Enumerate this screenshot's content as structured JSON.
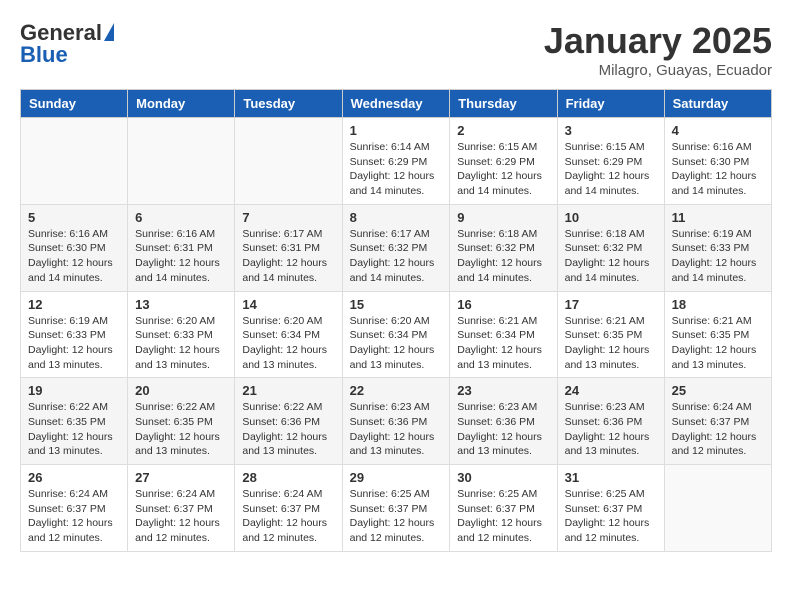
{
  "header": {
    "logo_general": "General",
    "logo_blue": "Blue",
    "month_title": "January 2025",
    "location": "Milagro, Guayas, Ecuador"
  },
  "days_of_week": [
    "Sunday",
    "Monday",
    "Tuesday",
    "Wednesday",
    "Thursday",
    "Friday",
    "Saturday"
  ],
  "weeks": [
    {
      "alt": false,
      "days": [
        {
          "num": "",
          "info": ""
        },
        {
          "num": "",
          "info": ""
        },
        {
          "num": "",
          "info": ""
        },
        {
          "num": "1",
          "info": "Sunrise: 6:14 AM\nSunset: 6:29 PM\nDaylight: 12 hours\nand 14 minutes."
        },
        {
          "num": "2",
          "info": "Sunrise: 6:15 AM\nSunset: 6:29 PM\nDaylight: 12 hours\nand 14 minutes."
        },
        {
          "num": "3",
          "info": "Sunrise: 6:15 AM\nSunset: 6:29 PM\nDaylight: 12 hours\nand 14 minutes."
        },
        {
          "num": "4",
          "info": "Sunrise: 6:16 AM\nSunset: 6:30 PM\nDaylight: 12 hours\nand 14 minutes."
        }
      ]
    },
    {
      "alt": true,
      "days": [
        {
          "num": "5",
          "info": "Sunrise: 6:16 AM\nSunset: 6:30 PM\nDaylight: 12 hours\nand 14 minutes."
        },
        {
          "num": "6",
          "info": "Sunrise: 6:16 AM\nSunset: 6:31 PM\nDaylight: 12 hours\nand 14 minutes."
        },
        {
          "num": "7",
          "info": "Sunrise: 6:17 AM\nSunset: 6:31 PM\nDaylight: 12 hours\nand 14 minutes."
        },
        {
          "num": "8",
          "info": "Sunrise: 6:17 AM\nSunset: 6:32 PM\nDaylight: 12 hours\nand 14 minutes."
        },
        {
          "num": "9",
          "info": "Sunrise: 6:18 AM\nSunset: 6:32 PM\nDaylight: 12 hours\nand 14 minutes."
        },
        {
          "num": "10",
          "info": "Sunrise: 6:18 AM\nSunset: 6:32 PM\nDaylight: 12 hours\nand 14 minutes."
        },
        {
          "num": "11",
          "info": "Sunrise: 6:19 AM\nSunset: 6:33 PM\nDaylight: 12 hours\nand 14 minutes."
        }
      ]
    },
    {
      "alt": false,
      "days": [
        {
          "num": "12",
          "info": "Sunrise: 6:19 AM\nSunset: 6:33 PM\nDaylight: 12 hours\nand 13 minutes."
        },
        {
          "num": "13",
          "info": "Sunrise: 6:20 AM\nSunset: 6:33 PM\nDaylight: 12 hours\nand 13 minutes."
        },
        {
          "num": "14",
          "info": "Sunrise: 6:20 AM\nSunset: 6:34 PM\nDaylight: 12 hours\nand 13 minutes."
        },
        {
          "num": "15",
          "info": "Sunrise: 6:20 AM\nSunset: 6:34 PM\nDaylight: 12 hours\nand 13 minutes."
        },
        {
          "num": "16",
          "info": "Sunrise: 6:21 AM\nSunset: 6:34 PM\nDaylight: 12 hours\nand 13 minutes."
        },
        {
          "num": "17",
          "info": "Sunrise: 6:21 AM\nSunset: 6:35 PM\nDaylight: 12 hours\nand 13 minutes."
        },
        {
          "num": "18",
          "info": "Sunrise: 6:21 AM\nSunset: 6:35 PM\nDaylight: 12 hours\nand 13 minutes."
        }
      ]
    },
    {
      "alt": true,
      "days": [
        {
          "num": "19",
          "info": "Sunrise: 6:22 AM\nSunset: 6:35 PM\nDaylight: 12 hours\nand 13 minutes."
        },
        {
          "num": "20",
          "info": "Sunrise: 6:22 AM\nSunset: 6:35 PM\nDaylight: 12 hours\nand 13 minutes."
        },
        {
          "num": "21",
          "info": "Sunrise: 6:22 AM\nSunset: 6:36 PM\nDaylight: 12 hours\nand 13 minutes."
        },
        {
          "num": "22",
          "info": "Sunrise: 6:23 AM\nSunset: 6:36 PM\nDaylight: 12 hours\nand 13 minutes."
        },
        {
          "num": "23",
          "info": "Sunrise: 6:23 AM\nSunset: 6:36 PM\nDaylight: 12 hours\nand 13 minutes."
        },
        {
          "num": "24",
          "info": "Sunrise: 6:23 AM\nSunset: 6:36 PM\nDaylight: 12 hours\nand 13 minutes."
        },
        {
          "num": "25",
          "info": "Sunrise: 6:24 AM\nSunset: 6:37 PM\nDaylight: 12 hours\nand 12 minutes."
        }
      ]
    },
    {
      "alt": false,
      "days": [
        {
          "num": "26",
          "info": "Sunrise: 6:24 AM\nSunset: 6:37 PM\nDaylight: 12 hours\nand 12 minutes."
        },
        {
          "num": "27",
          "info": "Sunrise: 6:24 AM\nSunset: 6:37 PM\nDaylight: 12 hours\nand 12 minutes."
        },
        {
          "num": "28",
          "info": "Sunrise: 6:24 AM\nSunset: 6:37 PM\nDaylight: 12 hours\nand 12 minutes."
        },
        {
          "num": "29",
          "info": "Sunrise: 6:25 AM\nSunset: 6:37 PM\nDaylight: 12 hours\nand 12 minutes."
        },
        {
          "num": "30",
          "info": "Sunrise: 6:25 AM\nSunset: 6:37 PM\nDaylight: 12 hours\nand 12 minutes."
        },
        {
          "num": "31",
          "info": "Sunrise: 6:25 AM\nSunset: 6:37 PM\nDaylight: 12 hours\nand 12 minutes."
        },
        {
          "num": "",
          "info": ""
        }
      ]
    }
  ]
}
